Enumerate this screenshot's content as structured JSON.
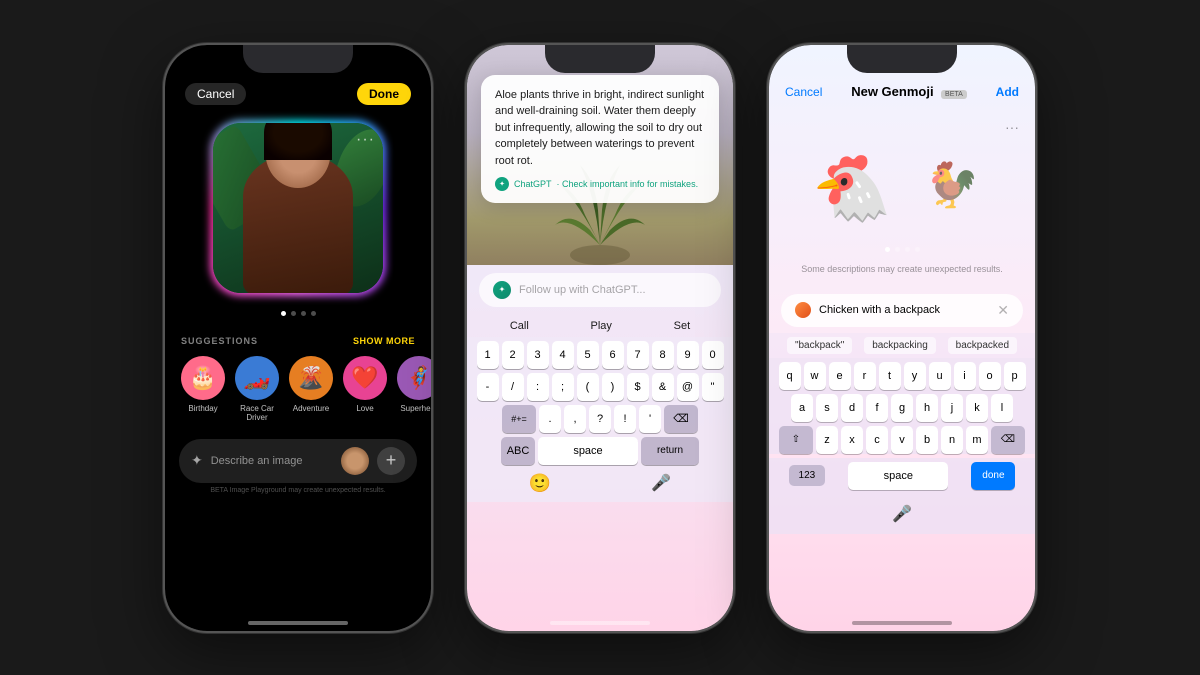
{
  "background": "#1a1a1a",
  "phone1": {
    "cancel_label": "Cancel",
    "done_label": "Done",
    "describe_placeholder": "Describe an image",
    "suggestions_label": "SUGGESTIONS",
    "show_more_label": "SHOW MORE",
    "beta_notice": "BETA  Image Playground may create unexpected results.",
    "suggestions": [
      {
        "label": "Birthday",
        "emoji": "🎂",
        "bg": "#ff6b8a"
      },
      {
        "label": "Race Car Driver",
        "emoji": "🏎️",
        "bg": "#3a7bd5"
      },
      {
        "label": "Adventure",
        "emoji": "🌋",
        "bg": "#e67e22"
      },
      {
        "label": "Love",
        "emoji": "❤️",
        "bg": "#e84393"
      },
      {
        "label": "Superhero",
        "emoji": "🦸",
        "bg": "#9b59b6"
      }
    ],
    "page_dots": [
      true,
      false,
      false,
      false
    ]
  },
  "phone2": {
    "tooltip_text": "Aloe plants thrive in bright, indirect sunlight and well-draining soil. Water them deeply but infrequently, allowing the soil to dry out completely between waterings to prevent root rot.",
    "tooltip_source": "ChatGPT",
    "tooltip_disclaimer": "· Check important info for mistakes.",
    "input_placeholder": "Follow up with ChatGPT...",
    "keyboard_suggestions": [
      "Call",
      "Play",
      "Set"
    ],
    "keys_row1": [
      "1",
      "2",
      "3",
      "4",
      "5",
      "6",
      "7",
      "8",
      "9",
      "0"
    ],
    "keys_row2": [
      "-",
      "/",
      ":",
      ";",
      "(",
      ")",
      "$",
      "&",
      "@",
      "\""
    ],
    "keys_row3": [
      "#+=",
      ".",
      ",",
      "?",
      "!",
      "'",
      "⌫"
    ],
    "keys_row4": [
      "ABC",
      "space",
      "return"
    ]
  },
  "phone3": {
    "cancel_label": "Cancel",
    "title_label": "New Genmoji",
    "beta_label": "BETA",
    "add_label": "Add",
    "notice_text": "Some descriptions may create unexpected results.",
    "search_value": "Chicken with a backpack",
    "kbd_suggestions": [
      "\"backpack\"",
      "backpacking",
      "backpacked"
    ],
    "keys_row1": [
      "q",
      "w",
      "e",
      "r",
      "t",
      "y",
      "u",
      "i",
      "o",
      "p"
    ],
    "keys_row2": [
      "a",
      "s",
      "d",
      "f",
      "g",
      "h",
      "j",
      "k",
      "l"
    ],
    "keys_row3": [
      "z",
      "x",
      "c",
      "v",
      "b",
      "n",
      "m"
    ],
    "num_label": "123",
    "space_label": "space",
    "done_key_label": "done",
    "page_dots": [
      true,
      false,
      false,
      false
    ]
  }
}
